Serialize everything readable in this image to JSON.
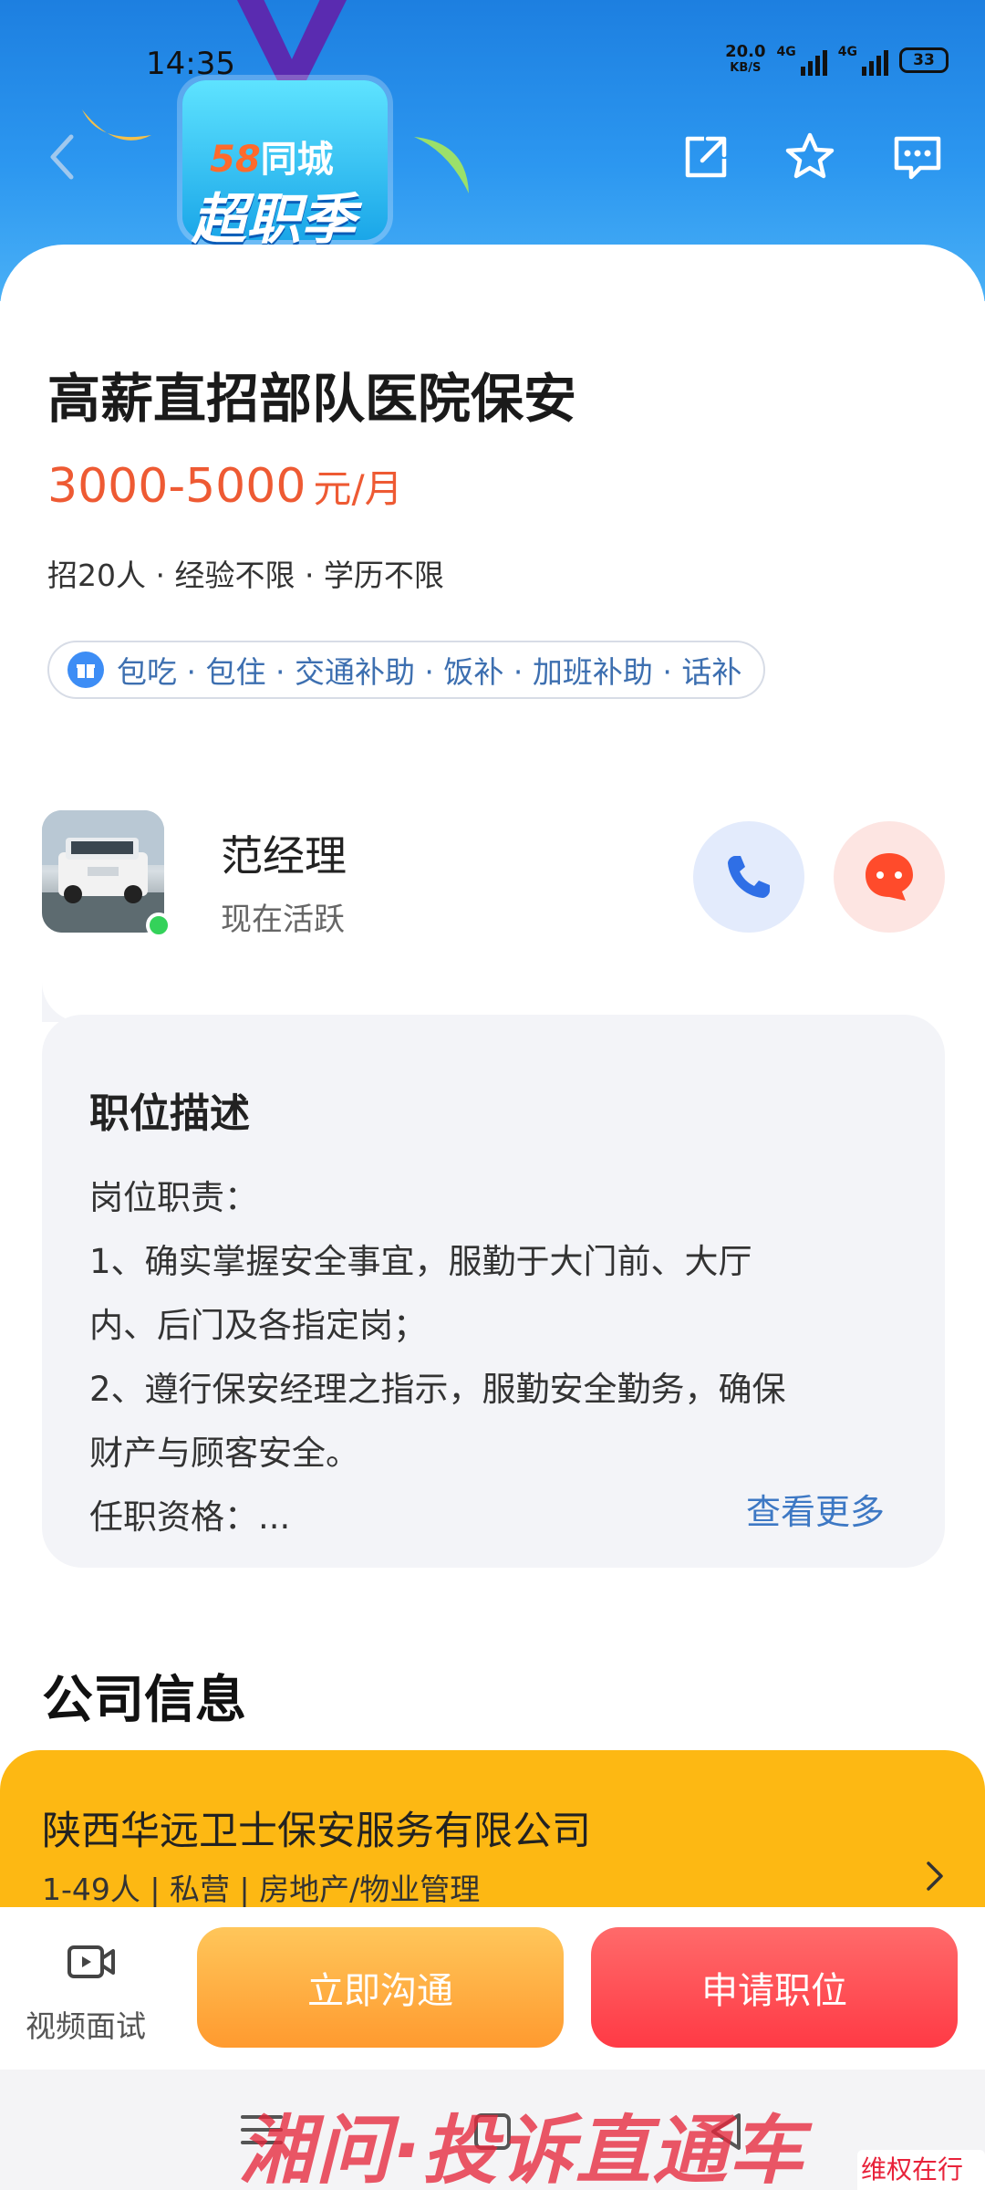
{
  "status_bar": {
    "time": "14:35",
    "net_speed": "20.0",
    "net_unit": "KB/S",
    "signal1_label": "4G",
    "signal2_label": "4G",
    "battery": "33"
  },
  "header": {
    "brand_58": "58",
    "brand_city": "同城",
    "brand_event": "超职季",
    "icons": [
      "back-icon",
      "share-icon",
      "star-icon",
      "message-icon"
    ]
  },
  "job": {
    "title": "高薪直招部队医院保安",
    "salary": "3000-5000",
    "salary_unit": "元/月",
    "requirements": "招20人 · 经验不限 · 学历不限",
    "benefits": "包吃 · 包住 · 交通补助 · 饭补 · 加班补助 · 话补"
  },
  "contact": {
    "name": "范经理",
    "status": "现在活跃"
  },
  "description": {
    "heading": "职位描述",
    "lines": [
      "岗位职责：",
      "1、确实掌握安全事宜，服勤于大门前、大厅",
      "内、后门及各指定岗；",
      "2、遵行保安经理之指示，服勤安全勤务，确保",
      "财产与顾客安全。",
      "任职资格：..."
    ],
    "more": "查看更多"
  },
  "company": {
    "heading": "公司信息",
    "name": "陕西华远卫士保安服务有限公司",
    "meta": "1-49人 | 私营 | 房地产/物业管理"
  },
  "actions": {
    "video_label": "视频面试",
    "chat_label": "立即沟通",
    "apply_label": "申请职位"
  },
  "watermark": {
    "main": "湘问·投诉直通车",
    "sub": "维权在行动"
  },
  "colors": {
    "salary": "#ee5a33",
    "call_blue": "#2f6fe6",
    "chat_red": "#ff4b2b",
    "company_card": "#fdb813",
    "apply_red": "#ff3a45",
    "chat_orange": "#ff9a2f"
  }
}
